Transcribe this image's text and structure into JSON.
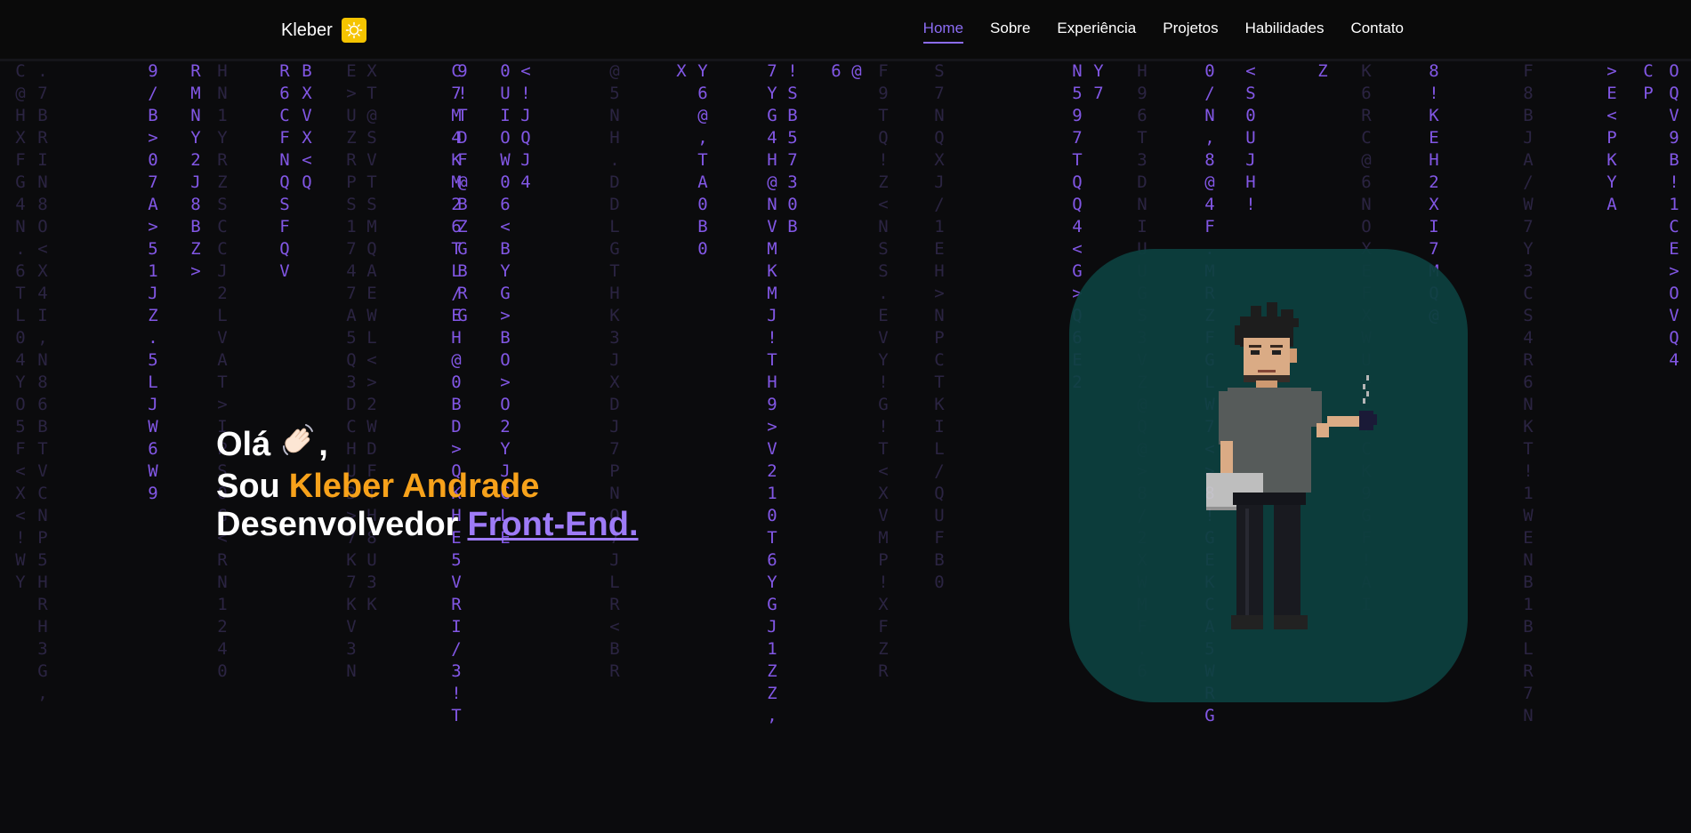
{
  "header": {
    "brand": "Kleber",
    "theme_icon": "sun-icon",
    "nav": [
      {
        "label": "Home",
        "active": true
      },
      {
        "label": "Sobre",
        "active": false
      },
      {
        "label": "Experiência",
        "active": false
      },
      {
        "label": "Projetos",
        "active": false
      },
      {
        "label": "Habilidades",
        "active": false
      },
      {
        "label": "Contato",
        "active": false
      }
    ]
  },
  "hero": {
    "greeting": "Olá",
    "greeting_icon": "waving-hand-icon",
    "greeting_comma": ",",
    "intro": "Sou",
    "name": "Kleber Andrade",
    "role_prefix": "Desenvolvedor",
    "role": "Front-End."
  },
  "illustration": {
    "icon": "pixel-developer-avatar-icon"
  },
  "colors": {
    "background": "#0b0b0d",
    "accent": "#8b6cf3",
    "name": "#f7a21b",
    "card": "#0d3f3e",
    "matrix_bright": "#8257e5",
    "matrix_dim": "#2b2442"
  },
  "matrix": {
    "columns": [
      {
        "bright": "",
        "dim": "C@HXFG4N.6TL04YO5F<X<!WY"
      },
      {
        "bright": "",
        "dim": ".7BRIN8O<X4I,N86BTVCNP5HRH3G,"
      },
      {
        "bright": "9/B>07A>51JZ.5LJW6W9",
        "dim": ""
      },
      {
        "bright": "RMNY2J8BZ>",
        "dim": ""
      },
      {
        "bright": "",
        "dim": "HN1YRZSCCJ2LVAT>IPS0G<RN1240"
      },
      {
        "bright": "R6CFNQSFQV",
        "dim": ""
      },
      {
        "bright": "BXVX<Q",
        "dim": ""
      },
      {
        "bright": "",
        "dim": "E>UZRPS1747A5Q3DCHU3>7K7KV3N"
      },
      {
        "bright": "",
        "dim": "XT@SVTSMQAEWL<>2WDFTH8U3K"
      },
      {
        "bright": "C7M4KM26TL/EH@0BD>QKHE5VRI/3!T",
        "dim": ""
      },
      {
        "bright": "9!TDF@BZGBRG",
        "dim": ""
      },
      {
        "bright": "0UIOW06<BYG>BO>O2YJCLE",
        "dim": ""
      },
      {
        "bright": "<!JQJ4",
        "dim": ""
      },
      {
        "bright": "",
        "dim": "@5NH.DDLGTHK3JXDJ7PNO7JLR<BR"
      },
      {
        "bright": "X",
        "dim": ""
      },
      {
        "bright": "Y6@,TA0B0",
        "dim": ""
      },
      {
        "bright": "7YG4H@NVMKMJ!TH9>V210T6YGJ1ZZ,",
        "dim": ""
      },
      {
        "bright": "!SB5730B",
        "dim": ""
      },
      {
        "bright": "6",
        "dim": ""
      },
      {
        "bright": "@",
        "dim": ""
      },
      {
        "bright": "",
        "dim": "F9TQ!Z<NSS.EVY!G!T<XVMP!XFZR"
      },
      {
        "bright": "",
        "dim": "S7NQXJ/1EH>NPCTKIL/QUFB0"
      },
      {
        "bright": "N597TQQ4<G>Q6E2",
        "dim": ""
      },
      {
        "bright": "Y7",
        "dim": ""
      },
      {
        "bright": "",
        "dim": "H96T3DNIUUGS3VZ@Q@>8/2XWMF.6"
      },
      {
        "bright": "0/N,8@4F.MRZFGLW7<>8!GEKCA5WRG",
        "dim": ""
      },
      {
        "bright": "<S0UJH!",
        "dim": ""
      },
      {
        "bright": "Z",
        "dim": ""
      },
      {
        "bright": "",
        "dim": "K6RC@6NOXEFXWU>E.CK9GF!AI"
      },
      {
        "bright": "8!KEH2XI7MQ@",
        "dim": ""
      },
      {
        "bright": "",
        "dim": "F8BJA/W7Y3CS4R6NKT!1WENB1BLR7N"
      },
      {
        "bright": ">E<PKYA",
        "dim": ""
      },
      {
        "bright": "CP",
        "dim": ""
      },
      {
        "bright": "OQV9B!1CE>OVQ4",
        "dim": ""
      }
    ]
  }
}
